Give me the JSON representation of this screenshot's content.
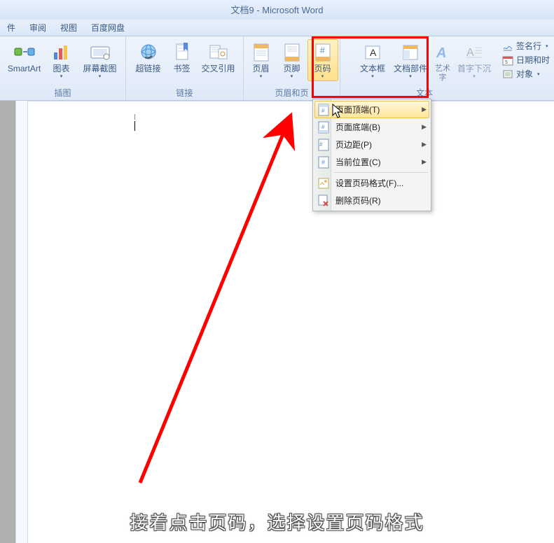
{
  "title": "文档9 - Microsoft Word",
  "tabs": {
    "t1": "件",
    "t2": "审阅",
    "t3": "视图",
    "t4": "百度网盘"
  },
  "ribbon": {
    "smartart": "SmartArt",
    "chart": "图表",
    "screenshot": "屏幕截图",
    "hyperlink": "超链接",
    "bookmark": "书签",
    "crossref": "交叉引用",
    "header": "页眉",
    "footer": "页脚",
    "pagenum": "页码",
    "textbox": "文本框",
    "quickparts": "文档部件",
    "wordart": "艺术字",
    "dropcap": "首字下沉",
    "sigline": "签名行",
    "datetime": "日期和时",
    "object": "对象",
    "group_illust": "插图",
    "group_links": "链接",
    "group_hf": "页眉和页",
    "group_text": "文本"
  },
  "menu": {
    "top": "页面顶端(T)",
    "bottom": "页面底端(B)",
    "margins": "页边距(P)",
    "current": "当前位置(C)",
    "format": "设置页码格式(F)...",
    "remove": "删除页码(R)"
  },
  "caption": "接着点击页码，选择设置页码格式"
}
